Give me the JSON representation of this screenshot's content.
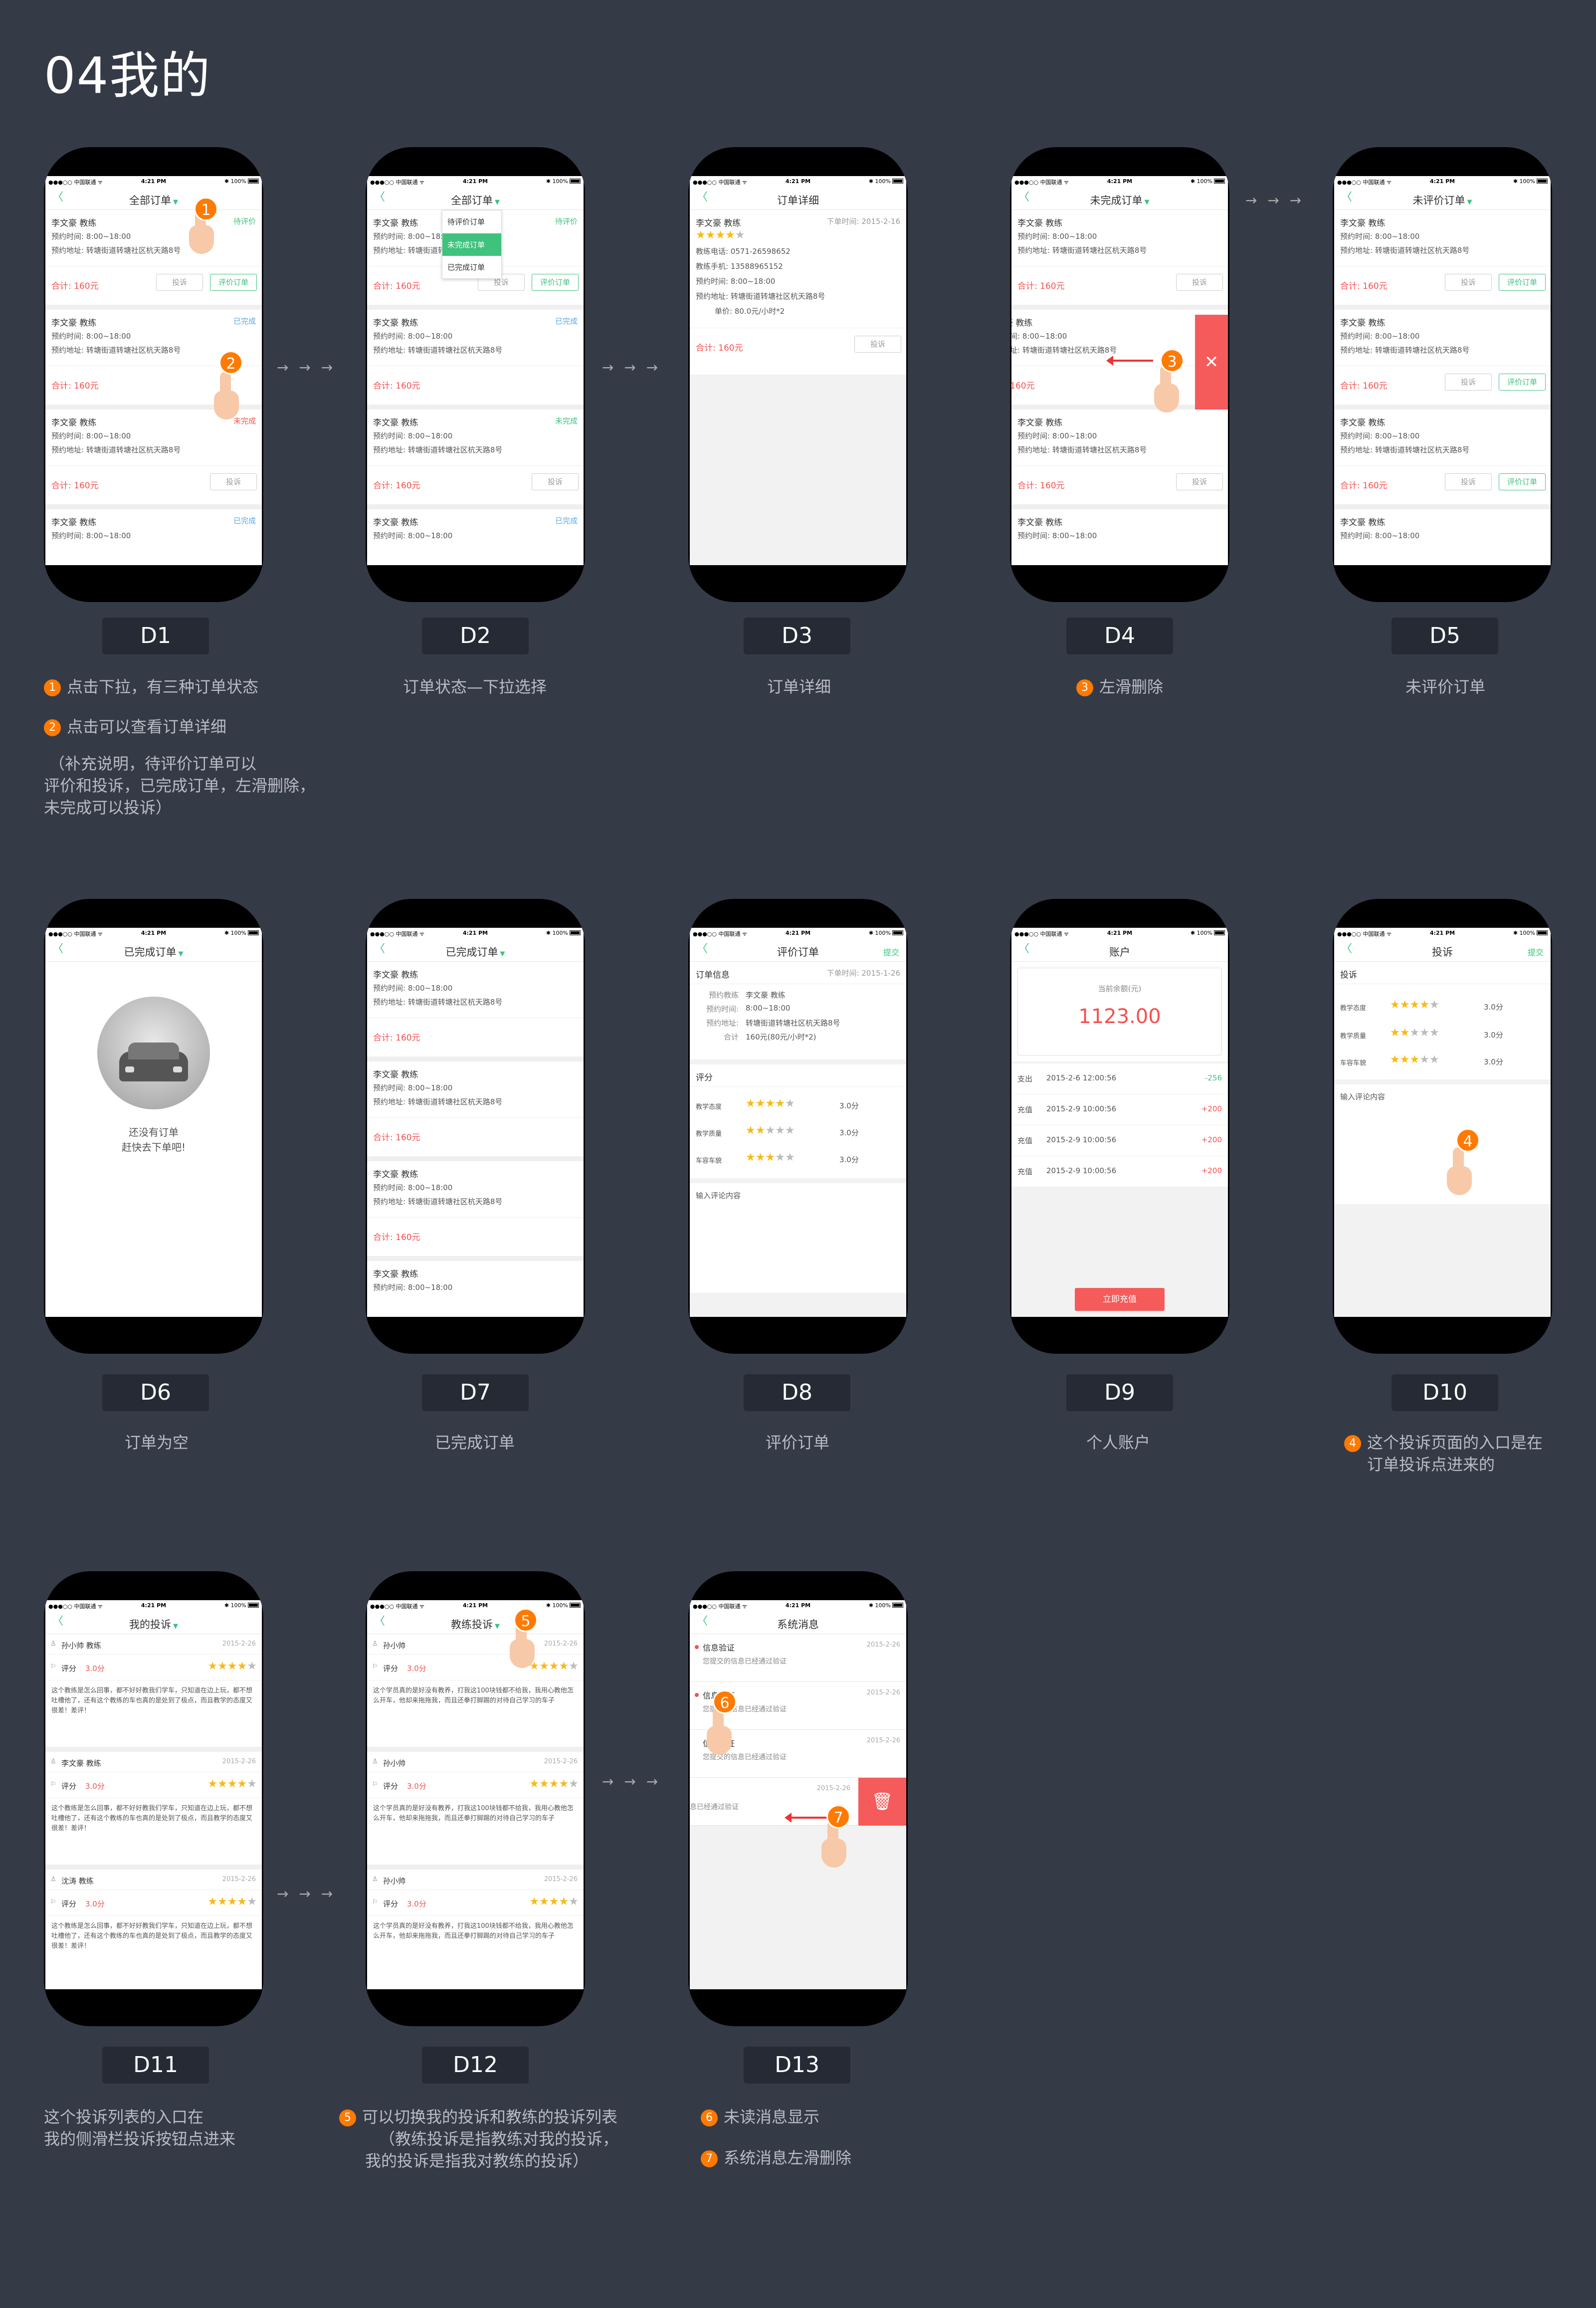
{
  "page_title": "04我的",
  "status": {
    "carrier": "●●●○○ 中国联通 ᯤ",
    "time": "4:21 PM",
    "battery": "✱ 100%"
  },
  "common": {
    "name": "李文豪 教练",
    "time_label": "预约时间:",
    "time_value": "8:00~18:00",
    "addr_label": "预约地址:",
    "addr_value": "转塘街道转塘社区杭天路8号",
    "total": "合计:  160元",
    "complain": "投诉",
    "review": "评价订单"
  },
  "status_labels": {
    "pending": "待评价",
    "done": "已完成",
    "unfinished": "未完成"
  },
  "nav": {
    "all": "全部订单",
    "detail": "订单详细",
    "unfinished": "未完成订单",
    "pending": "未评价订单",
    "completed": "已完成订单",
    "review": "评价订单",
    "account": "账户",
    "complain": "投诉",
    "my_complain": "我的投诉",
    "coach_complain": "教练投诉",
    "messages": "系统消息",
    "submit": "提交"
  },
  "dropdown": [
    "待评价订单",
    "未完成订单",
    "已完成订单"
  ],
  "detail": {
    "order_time": "下单时间:  2015-2-16",
    "phone_label": "教练电话:",
    "phone": "0571-26598652",
    "mobile_label": "教练手机:",
    "mobile": "13588965152",
    "price_label": "单价:",
    "price": "80.0元/小时*2",
    "total": "合计:  160元"
  },
  "empty": {
    "line1": "还没有订单",
    "line2": "赶快去下单吧!"
  },
  "review": {
    "section": "订单信息",
    "order_time": "下单时间:  2015-1-26",
    "coach_label": "预约教练",
    "coach": "李文豪 教练",
    "total_label": "合计",
    "total": "160元(80元/小时*2)",
    "rating": "评分",
    "r1": "教学态度",
    "r2": "教学质量",
    "r3": "车容车貌",
    "score": "3.0分",
    "input": "输入评论内容"
  },
  "account": {
    "balance_label": "当前余额(元)",
    "balance": "1123.00",
    "rows": [
      {
        "type": "支出",
        "date": "2015-2-6   12:00:56",
        "amt": "-256"
      },
      {
        "type": "充值",
        "date": "2015-2-9   10:00:56",
        "amt": "+200"
      },
      {
        "type": "充值",
        "date": "2015-2-9   10:00:56",
        "amt": "+200"
      },
      {
        "type": "充值",
        "date": "2015-2-9   10:00:56",
        "amt": "+200"
      }
    ],
    "topup": "立即充值"
  },
  "complaint": {
    "section": "投诉",
    "input": "输入评论内容"
  },
  "d11": {
    "rating": "评分",
    "score": "3.0分",
    "date": "2015-2-26",
    "text": "这个教练是怎么回事，都不好好教我们学车，只知道在边上玩，都不想吐槽他了，还有这个教练的车也真的是处到了极点，而且教学的态度又很差！差评！",
    "coaches": [
      "孙小帅 教练",
      "李文豪 教练",
      "沈涛 教练"
    ]
  },
  "d12": {
    "names": [
      "孙小帅",
      "孙小帅",
      "孙小帅"
    ],
    "text": "这个学员真的是好没有教养，打我这100块钱都不给我，我用心教他怎么开车，他却来拖拖我，而且还拳打脚踢的对待自己学习的车子"
  },
  "d13": {
    "title": "信息验证",
    "sub": "您提交的信息已经通过验证",
    "date": "2015-2-26",
    "swipe_text": "息已经通过验证"
  },
  "labels": [
    "D1",
    "D2",
    "D3",
    "D4",
    "D5",
    "D6",
    "D7",
    "D8",
    "D9",
    "D10",
    "D11",
    "D12",
    "D13"
  ],
  "descs": {
    "d1a": "点击下拉，有三种订单状态",
    "d1b": "点击可以查看订单详细",
    "d1c1": "（补充说明，待评价订单可以",
    "d1c2": "评价和投诉，已完成订单，左滑删除，",
    "d1c3": "未完成可以投诉）",
    "d2": "订单状态—下拉选择",
    "d3": "订单详细",
    "d4": "左滑删除",
    "d5": "未评价订单",
    "d6": "订单为空",
    "d7": "已完成订单",
    "d8": "评价订单",
    "d9": "个人账户",
    "d10a": "这个投诉页面的入口是在",
    "d10b": "订单投诉点进来的",
    "d11a": "这个投诉列表的入口在",
    "d11b": "我的侧滑栏投诉按钮点进来",
    "d12a": "可以切换我的投诉和教练的投诉列表",
    "d12b": "（教练投诉是指教练对我的投诉，",
    "d12c": "我的投诉是指我对教练的投诉）",
    "d13a": "未读消息显示",
    "d13b": "系统消息左滑删除"
  },
  "badges": [
    "1",
    "2",
    "3",
    "4",
    "5",
    "6",
    "7"
  ],
  "flow": "→ → →",
  "colors": {
    "bg": "#353a47",
    "green": "#3ec27e",
    "red": "#f5504f",
    "orange": "#ff7a00"
  }
}
